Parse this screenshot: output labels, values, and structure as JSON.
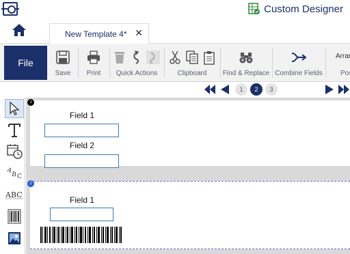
{
  "app": {
    "brand_name": "Custom Designer"
  },
  "tabs": {
    "doc_title": "New Template 4*",
    "close_glyph": "✕"
  },
  "ribbon": {
    "file_label": "File",
    "groups": [
      {
        "label": "Save"
      },
      {
        "label": "Print"
      },
      {
        "label": "Quick Actions"
      },
      {
        "label": "Clipboard"
      },
      {
        "label": "Find & Replace"
      },
      {
        "label": "Combine Fields"
      },
      {
        "label": "Arrange"
      },
      {
        "label": "Position"
      }
    ]
  },
  "pagenav": {
    "pages": [
      "1",
      "2",
      "3"
    ],
    "current_page": "2"
  },
  "labels": [
    {
      "badge": "1",
      "fields": [
        {
          "name": "Field 1"
        },
        {
          "name": "Field 2"
        }
      ]
    },
    {
      "badge": "2",
      "fields": [
        {
          "name": "Field 1"
        }
      ]
    }
  ],
  "icons": {
    "title": "app-logo-icon",
    "brand": "spreadsheet-check-icon",
    "home": "home-icon",
    "tools": [
      "pointer-icon",
      "text-icon",
      "date-time-icon",
      "curved-text-icon",
      "outlined-text-icon",
      "barcode-icon",
      "image-icon"
    ]
  },
  "colors": {
    "brand": "#1b2f6b",
    "field_border": "#3d7aa8",
    "canvas": "#d9d9d9",
    "ribbon": "#f2f2f2"
  }
}
